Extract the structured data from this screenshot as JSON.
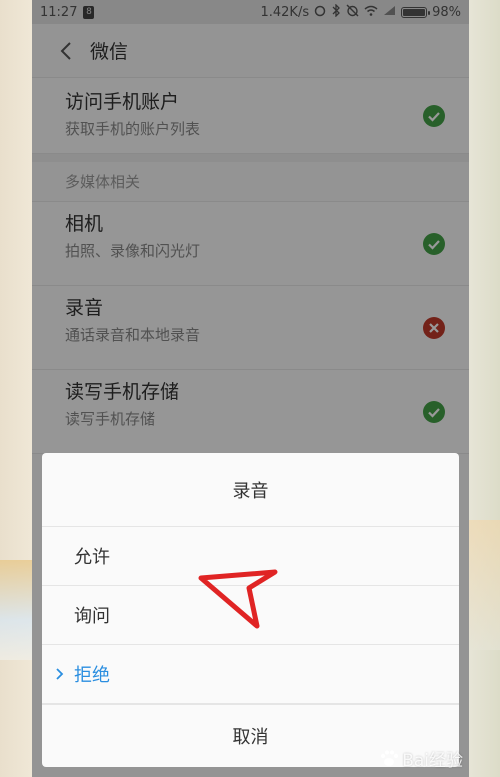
{
  "status_bar": {
    "time": "11:27",
    "notification_badge": "8",
    "network_speed": "1.42K/s",
    "battery_percent": "98%",
    "battery_level": 0.98
  },
  "header": {
    "title": "微信"
  },
  "permissions": [
    {
      "title": "访问手机账户",
      "desc": "获取手机的账户列表",
      "status": "allowed"
    },
    {
      "section": "多媒体相关"
    },
    {
      "title": "相机",
      "desc": "拍照、录像和闪光灯",
      "status": "allowed"
    },
    {
      "title": "录音",
      "desc": "通话录音和本地录音",
      "status": "denied"
    },
    {
      "title": "读写手机存储",
      "desc": "读写手机存储",
      "status": "allowed"
    }
  ],
  "dialog": {
    "title": "录音",
    "options": [
      {
        "label": "允许",
        "selected": false
      },
      {
        "label": "询问",
        "selected": false
      },
      {
        "label": "拒绝",
        "selected": true
      }
    ],
    "cancel_label": "取消"
  },
  "watermark": {
    "text": "Bai经验"
  },
  "colors": {
    "allowed": "#43a047",
    "denied": "#c0392b",
    "selected": "#2a8ee0",
    "annotation": "#e02424"
  }
}
